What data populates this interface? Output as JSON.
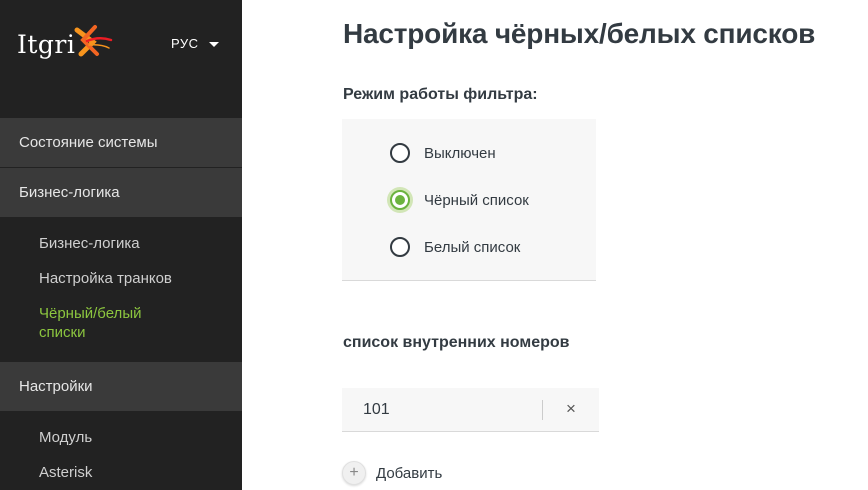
{
  "brand": {
    "logo_text": "Itgri"
  },
  "header": {
    "language": "РУС"
  },
  "sidebar": {
    "sections": [
      {
        "label": "Состояние системы"
      },
      {
        "label": "Бизнес-логика"
      },
      {
        "label": "Настройки"
      }
    ],
    "business_items": [
      {
        "label": "Бизнес-логика"
      },
      {
        "label": "Настройка транков"
      },
      {
        "label": "Чёрный/белый списки",
        "active": true
      }
    ],
    "settings_items": [
      {
        "label": "Модуль"
      },
      {
        "label": "Asterisk"
      }
    ]
  },
  "main": {
    "title": "Настройка чёрных/белых списков",
    "filter_mode": {
      "label": "Режим работы фильтра:",
      "options": [
        {
          "label": "Выключен",
          "checked": false
        },
        {
          "label": "Чёрный список",
          "checked": true
        },
        {
          "label": "Белый список",
          "checked": false
        }
      ]
    },
    "numbers": {
      "label": "список внутренних номеров",
      "items": [
        {
          "value": "101",
          "remove": "×"
        }
      ],
      "add_icon": "+",
      "add_label": "Добавить"
    }
  },
  "colors": {
    "accent": "#8cc63f",
    "sidebar_bg": "#222222",
    "sidebar_section_bg": "#3a3a3a",
    "text_dark": "#333b42"
  },
  "icons": [
    "itgrix-logo-mark",
    "caret-down-icon",
    "radio-icon",
    "close-icon",
    "plus-icon"
  ]
}
